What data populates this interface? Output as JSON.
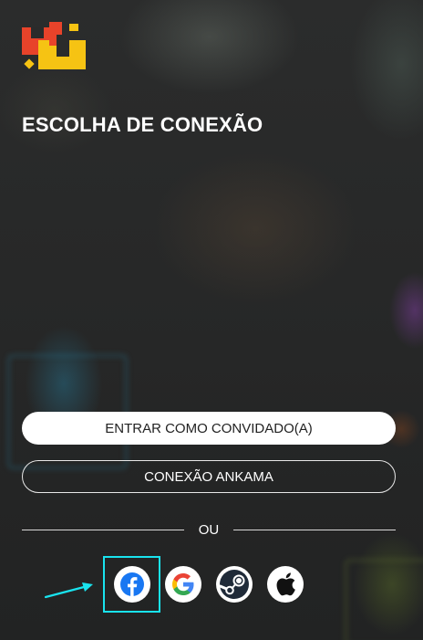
{
  "header": {
    "title": "ESCOLHA DE CONEXÃO"
  },
  "buttons": {
    "guest_label": "ENTRAR COMO CONVIDADO(A)",
    "ankama_label": "CONEXÃO ANKAMA"
  },
  "divider": {
    "or_label": "OU"
  },
  "social": [
    {
      "name": "facebook",
      "icon": "facebook-icon"
    },
    {
      "name": "google",
      "icon": "google-icon"
    },
    {
      "name": "steam",
      "icon": "steam-icon"
    },
    {
      "name": "apple",
      "icon": "apple-icon"
    }
  ],
  "colors": {
    "background": "#2a2b2b",
    "highlight": "#19e3ee",
    "facebook_blue": "#1877f2",
    "logo_red": "#e8432a",
    "logo_yellow": "#f6c313"
  }
}
